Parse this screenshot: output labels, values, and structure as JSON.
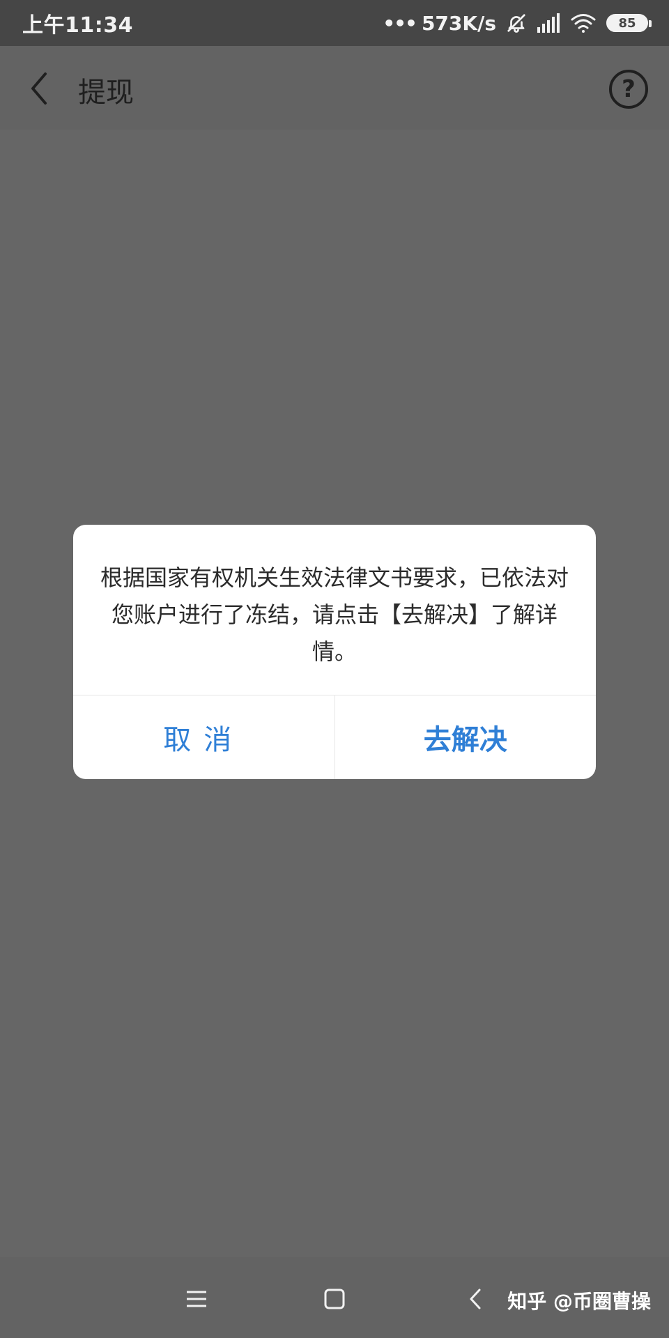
{
  "status_bar": {
    "time": "上午11:34",
    "net_speed": "573K/s",
    "battery": "85",
    "dots": "•••",
    "icons": {
      "mute": "bell-off-icon",
      "signal": "signal-icon",
      "wifi": "wifi-icon"
    }
  },
  "header": {
    "title": "提现",
    "back_icon": "back-arrow-icon",
    "help_icon": "help-icon",
    "help_glyph": "?"
  },
  "dialog": {
    "message": "根据国家有权机关生效法律文书要求，已依法对您账户进行了冻结，请点击【去解决】了解详情。",
    "cancel_label": "取消",
    "primary_label": "去解决"
  },
  "bottom_nav": {
    "menu_icon": "menu-icon",
    "home_icon": "home-icon",
    "back_icon": "back-icon"
  },
  "watermark": "知乎 @币圈曹操",
  "colors": {
    "status_bar_bg": "#464646",
    "overlay_bg": "#666666",
    "dialog_button_text": "#2f7fd6"
  }
}
